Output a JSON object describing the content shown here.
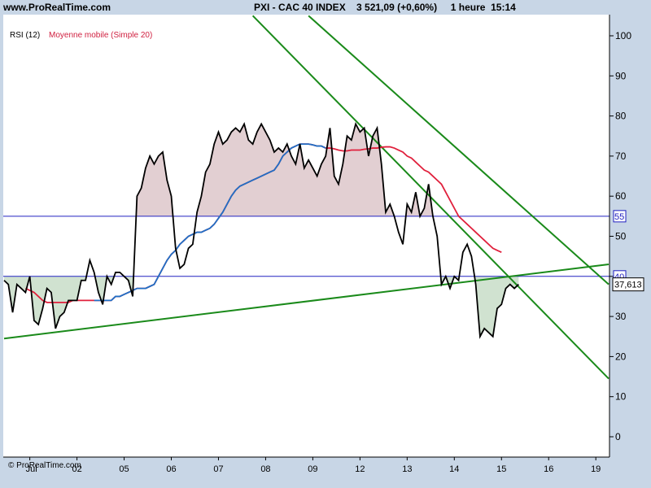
{
  "header": {
    "site": "www.ProRealTime.com",
    "title": "PXI - CAC 40 INDEX    3 521,09 (+0,60%)     1 heure  15:14"
  },
  "legend": {
    "rsi_label": "RSI (12)",
    "ma_label": "Moyenne mobile (Simple 20)"
  },
  "copyright": "© ProRealTime.com",
  "colors": {
    "rsi": "#000000",
    "ma": "#e0203c",
    "ma_early": "#1f6fc6",
    "trendline": "#1a8a1a",
    "level": "#2020c0",
    "fill_high": "#e2cfd2",
    "fill_low": "#d0e2d0"
  },
  "chart_data": {
    "type": "line",
    "ylim": [
      -5,
      105
    ],
    "y_ticks": [
      0,
      10,
      20,
      30,
      40,
      50,
      60,
      70,
      80,
      90,
      100
    ],
    "levels": [
      {
        "value": 55,
        "label": "55"
      },
      {
        "value": 40,
        "label": "40"
      }
    ],
    "last_value_label": "37,613",
    "x_labels": [
      "Jul",
      "02",
      "05",
      "06",
      "07",
      "08",
      "09",
      "12",
      "13",
      "14",
      "15",
      "16",
      "19"
    ],
    "x_label_index": [
      6,
      17,
      28,
      39,
      50,
      61,
      72,
      83,
      94,
      105,
      116,
      127,
      138
    ],
    "series": [
      {
        "key": "rsi",
        "values": [
          39,
          38,
          31,
          38,
          37,
          36,
          40,
          29,
          28,
          32,
          37,
          36,
          27,
          30,
          31,
          34,
          34,
          34,
          39,
          39,
          44,
          41,
          36,
          33,
          40,
          38,
          41,
          41,
          40,
          39,
          35,
          60,
          62,
          67,
          70,
          68,
          70,
          71,
          64,
          60,
          47,
          42,
          43,
          47,
          48,
          56,
          60,
          66,
          68,
          73,
          76,
          73,
          74,
          76,
          77,
          76,
          78,
          74,
          73,
          76,
          78,
          76,
          74,
          71,
          72,
          71,
          73,
          70,
          68,
          73,
          67,
          69,
          67,
          65,
          68,
          70,
          77,
          65,
          63,
          68,
          75,
          74,
          78,
          76,
          77,
          70,
          75,
          77,
          68,
          56,
          58,
          55,
          51,
          48,
          58,
          56,
          61,
          55,
          57,
          63,
          55,
          50,
          38,
          40,
          37,
          40,
          39,
          46,
          48,
          45,
          38,
          25,
          27,
          26,
          25,
          32,
          33,
          37,
          38,
          37,
          38
        ],
        "start_index": 0
      },
      {
        "key": "ma",
        "values": [
          37,
          36.5,
          36,
          35,
          34,
          33.5,
          33.5,
          33.5,
          33.5,
          33.5,
          33.5,
          34,
          34,
          34,
          34,
          34,
          34,
          34,
          34,
          34,
          34,
          35,
          35,
          35.5,
          36,
          36.5,
          37,
          37,
          37,
          37.5,
          38,
          40,
          42,
          44,
          45.5,
          46.5,
          48,
          49,
          50,
          50.5,
          51,
          51,
          51.5,
          52,
          53,
          54.5,
          56,
          58,
          60,
          61.5,
          62.5,
          63,
          63.5,
          64,
          64.5,
          65,
          65.5,
          66,
          66.5,
          68,
          70,
          71,
          72,
          72.5,
          73,
          73,
          73,
          72.8,
          72.5,
          72.5,
          72,
          72,
          71.8,
          71.5,
          71.3,
          71.3,
          71.5,
          71.5,
          71.5,
          71.7,
          71.8,
          72,
          72,
          72.2,
          72.3,
          72.3,
          72,
          71.5,
          71,
          70,
          69.5,
          68.5,
          67.5,
          66.5,
          66,
          65,
          64,
          63,
          61,
          59,
          57,
          55,
          54,
          53,
          52,
          51,
          50,
          49,
          48,
          47,
          46.5,
          46
        ],
        "start_index": 5,
        "split_index": 75
      }
    ],
    "trendlines": [
      {
        "from": [
          0,
          24.5
        ],
        "to": [
          141,
          43
        ]
      },
      {
        "from": [
          58,
          105
        ],
        "to": [
          141,
          14.5
        ]
      },
      {
        "from": [
          71,
          105
        ],
        "to": [
          141,
          38
        ]
      }
    ]
  }
}
